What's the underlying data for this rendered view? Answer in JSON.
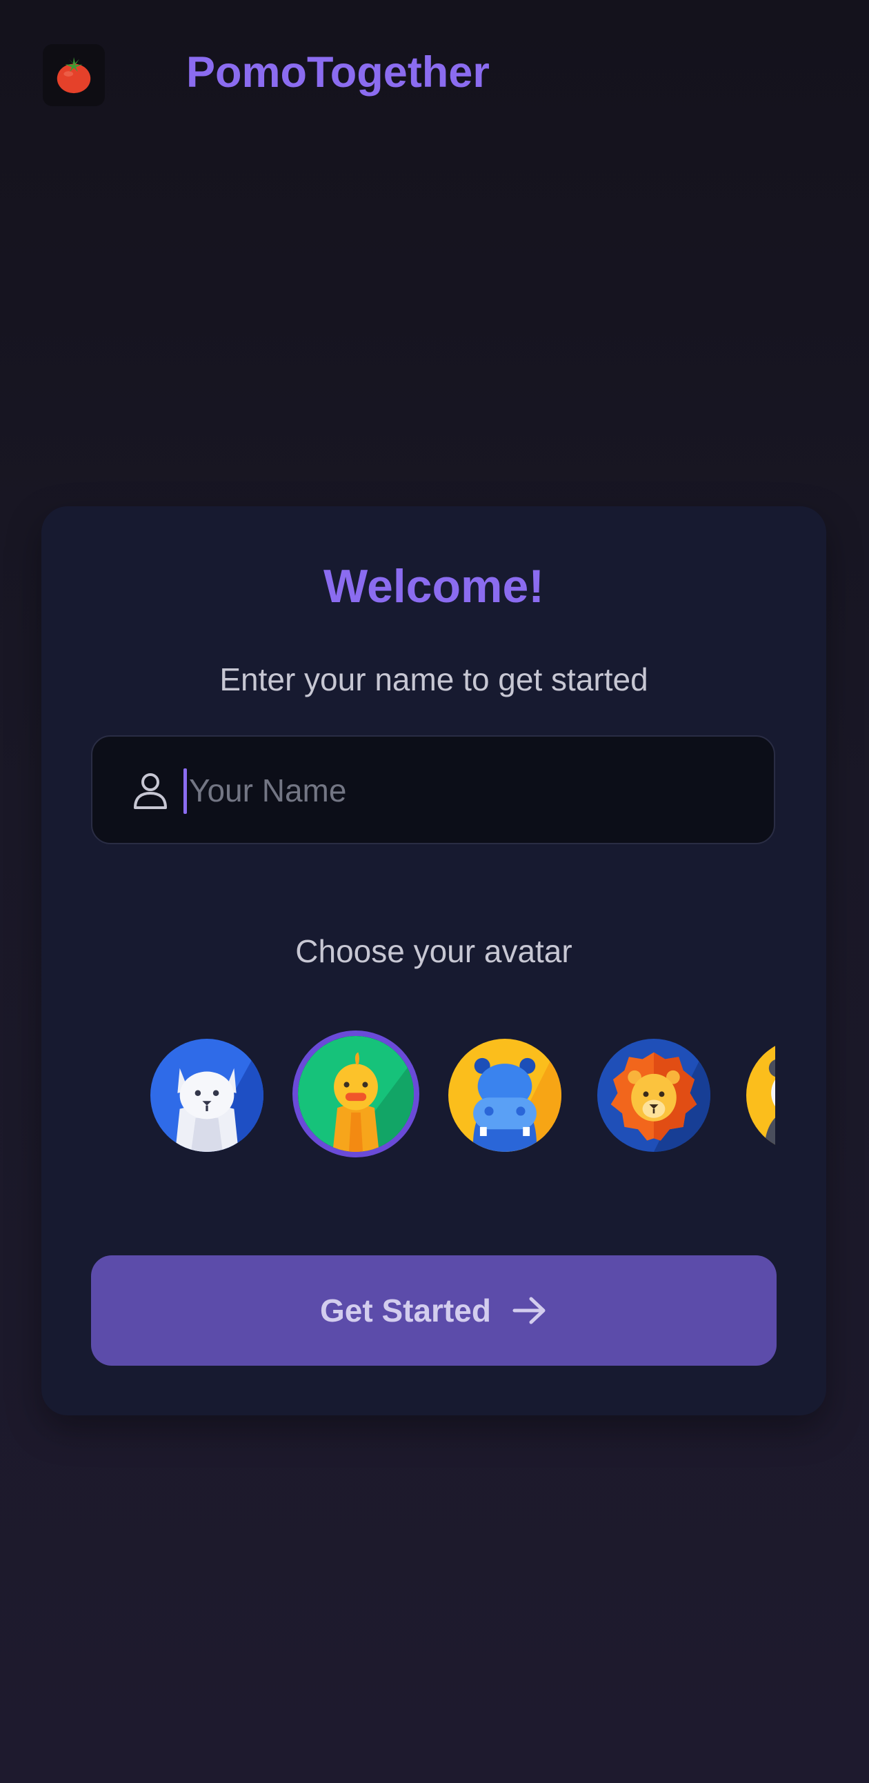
{
  "app": {
    "logo_icon": "tomato-icon",
    "title": "PomoTogether"
  },
  "welcome": {
    "title": "Welcome!",
    "subtitle": "Enter your name to get started"
  },
  "name_field": {
    "icon": "user-icon",
    "placeholder": "Your Name",
    "value": ""
  },
  "avatars": {
    "label": "Choose your avatar",
    "options": [
      {
        "name": "cat-avatar",
        "selected": false
      },
      {
        "name": "duck-avatar",
        "selected": true
      },
      {
        "name": "hippo-avatar",
        "selected": false
      },
      {
        "name": "lion-avatar",
        "selected": false
      },
      {
        "name": "panda-avatar",
        "selected": false
      }
    ]
  },
  "cta": {
    "label": "Get Started",
    "icon": "arrow-right-icon"
  },
  "colors": {
    "accent": "#8b6cf0",
    "button": "#5c4caa",
    "selected_ring": "#6a4bd8",
    "card": "#171a30",
    "background": "#14121c"
  }
}
